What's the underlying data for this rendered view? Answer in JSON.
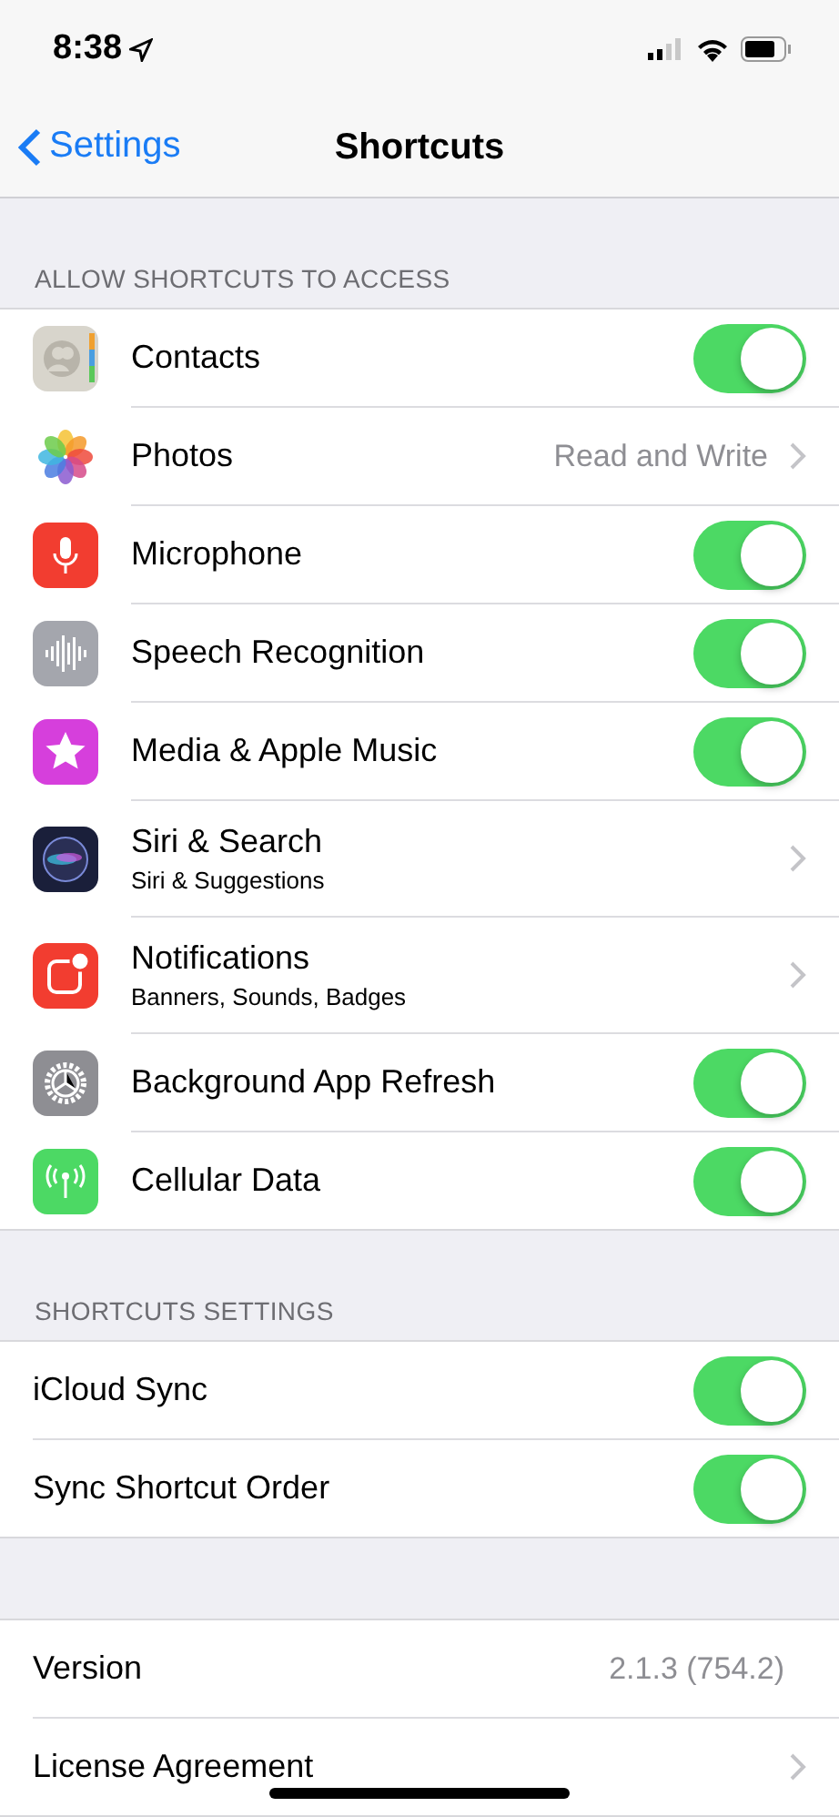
{
  "status_bar": {
    "time": "8:38"
  },
  "nav": {
    "back": "Settings",
    "title": "Shortcuts"
  },
  "sections": [
    {
      "header": "ALLOW SHORTCUTS TO ACCESS",
      "icons": true,
      "rows": [
        {
          "kind": "toggle",
          "label": "Contacts",
          "on": true
        },
        {
          "kind": "detail",
          "label": "Photos",
          "value": "Read and Write"
        },
        {
          "kind": "toggle",
          "label": "Microphone",
          "on": true
        },
        {
          "kind": "toggle",
          "label": "Speech Recognition",
          "on": true
        },
        {
          "kind": "toggle",
          "label": "Media & Apple Music",
          "on": true
        },
        {
          "kind": "link",
          "label": "Siri & Search",
          "subtitle": "Siri & Suggestions"
        },
        {
          "kind": "link",
          "label": "Notifications",
          "subtitle": "Banners, Sounds, Badges"
        },
        {
          "kind": "toggle",
          "label": "Background App Refresh",
          "on": true
        },
        {
          "kind": "toggle",
          "label": "Cellular Data",
          "on": true
        }
      ]
    },
    {
      "header": "SHORTCUTS SETTINGS",
      "icons": false,
      "rows": [
        {
          "kind": "toggle",
          "label": "iCloud Sync",
          "on": true
        },
        {
          "kind": "toggle",
          "label": "Sync Shortcut Order",
          "on": true
        }
      ]
    },
    {
      "icons": false,
      "rows": [
        {
          "kind": "detail",
          "label": "Version",
          "value": "2.1.3 (754.2)"
        },
        {
          "kind": "link",
          "label": "License Agreement"
        }
      ]
    }
  ]
}
